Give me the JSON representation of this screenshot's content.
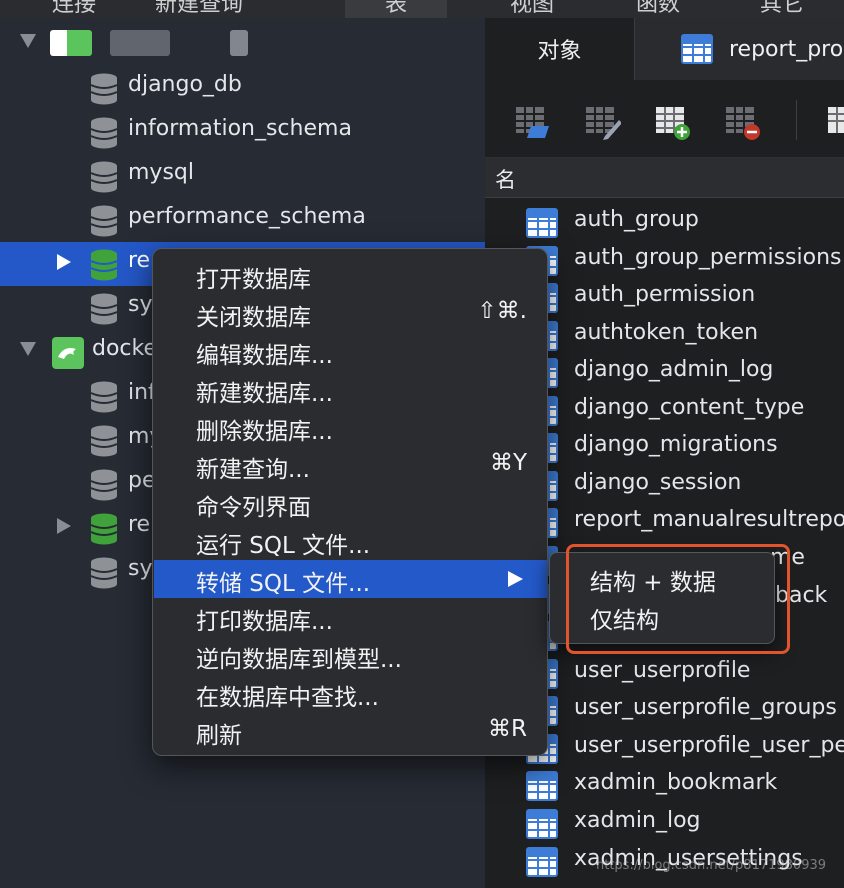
{
  "topbar": {
    "items": [
      "连接",
      "新建查询",
      "表",
      "视图",
      "函数",
      "其它"
    ]
  },
  "sidebar": {
    "connections": [
      {
        "label": "",
        "expanded": true
      },
      {
        "label": "docke",
        "expanded": true
      }
    ],
    "db_items": [
      {
        "label": "django_db"
      },
      {
        "label": "information_schema"
      },
      {
        "label": "mysql"
      },
      {
        "label": "performance_schema"
      },
      {
        "label": "re",
        "selected": true
      },
      {
        "label": "sy"
      },
      {
        "label": "inf"
      },
      {
        "label": "my"
      },
      {
        "label": "pe"
      },
      {
        "label": "re"
      },
      {
        "label": "sy"
      }
    ]
  },
  "tabs": {
    "objects": "对象",
    "report": "report_pro"
  },
  "table_header": "名",
  "tables": [
    "auth_group",
    "auth_group_permissions",
    "auth_permission",
    "authtoken_token",
    "django_admin_log",
    "django_content_type",
    "django_migrations",
    "django_session",
    "report_manualresultrepo",
    "me",
    "back",
    "",
    "user_userprofile",
    "user_userprofile_groups",
    "user_userprofile_user_pe",
    "xadmin_bookmark",
    "xadmin_log",
    "xadmin_usersettings"
  ],
  "context_menu": {
    "items": [
      {
        "label": "打开数据库",
        "shortcut": ""
      },
      {
        "label": "关闭数据库",
        "shortcut": "⇧⌘."
      },
      {
        "label": "编辑数据库...",
        "shortcut": ""
      },
      {
        "label": "新建数据库...",
        "shortcut": ""
      },
      {
        "label": "删除数据库...",
        "shortcut": ""
      },
      {
        "label": "新建查询...",
        "shortcut": "⌘Y"
      },
      {
        "label": "命令列界面",
        "shortcut": ""
      },
      {
        "label": "运行 SQL 文件...",
        "shortcut": ""
      },
      {
        "label": "转储 SQL 文件...",
        "shortcut": "",
        "highlighted": true,
        "submenu": true
      },
      {
        "label": "打印数据库...",
        "shortcut": ""
      },
      {
        "label": "逆向数据库到模型...",
        "shortcut": ""
      },
      {
        "label": "在数据库中查找...",
        "shortcut": ""
      },
      {
        "label": "刷新",
        "shortcut": "⌘R"
      }
    ]
  },
  "submenu": {
    "items": [
      "结构 + 数据",
      "仅结构"
    ]
  },
  "watermark": "https://blog.csdn.net/p8171980939",
  "colors": {
    "selection": "#2458c8",
    "highlight_box": "#e1542c",
    "db_icon_gray": "#8e9196",
    "db_icon_green": "#3fa23a"
  }
}
